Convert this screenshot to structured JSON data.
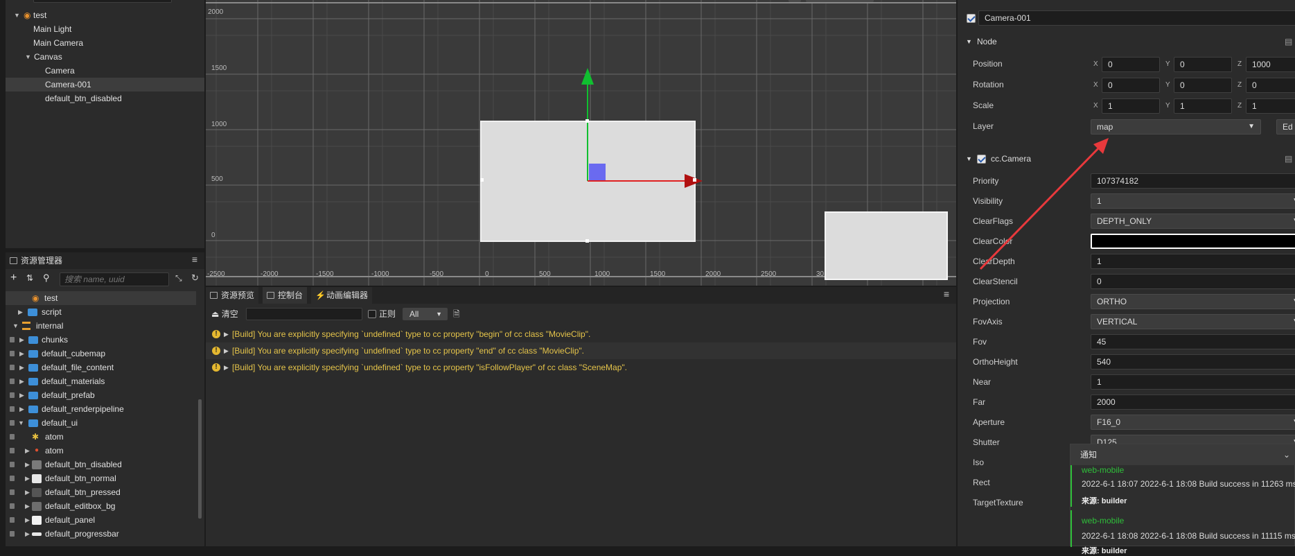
{
  "hierarchy": {
    "items": [
      "test",
      "Main Light",
      "Main Camera",
      "Canvas",
      "Camera",
      "Camera-001",
      "default_btn_disabled"
    ]
  },
  "assets": {
    "tab_label": "资源管理器",
    "search_placeholder": "搜索 name, uuid",
    "items": [
      "test",
      "script",
      "internal",
      "chunks",
      "default_cubemap",
      "default_file_content",
      "default_materials",
      "default_prefab",
      "default_renderpipeline",
      "default_ui",
      "atom",
      "atom",
      "default_btn_disabled",
      "default_btn_normal",
      "default_btn_pressed",
      "default_editbox_bg",
      "default_panel",
      "default_progressbar"
    ]
  },
  "scene": {
    "y_ticks": [
      "2000",
      "1500",
      "1000",
      "500",
      "0"
    ],
    "x_ticks": [
      "-2500",
      "-2000",
      "-1500",
      "-1000",
      "-500",
      "0",
      "500",
      "1000",
      "1500",
      "2000",
      "2500",
      "30"
    ]
  },
  "console": {
    "tabs": [
      "资源预览",
      "控制台",
      "动画编辑器"
    ],
    "clear_label": "清空",
    "regex_label": "正则",
    "filter_value": "All",
    "messages": [
      "[Build] You are explicitly specifying `undefined` type to cc property \"begin\" of cc class \"MovieClip\".",
      "[Build] You are explicitly specifying `undefined` type to cc property \"end\" of cc class \"MovieClip\".",
      "[Build] You are explicitly specifying `undefined` type to cc property \"isFollowPlayer\" of cc class \"SceneMap\"."
    ]
  },
  "inspector": {
    "node_name": "Camera-001",
    "node_section": "Node",
    "position_label": "Position",
    "position": {
      "x": "0",
      "y": "0",
      "z": "1000"
    },
    "rotation_label": "Rotation",
    "rotation": {
      "x": "0",
      "y": "0",
      "z": "0"
    },
    "scale_label": "Scale",
    "scale": {
      "x": "1",
      "y": "1",
      "z": "1"
    },
    "layer_label": "Layer",
    "layer_value": "map",
    "edit_label": "Ed",
    "axis_x": "X",
    "axis_y": "Y",
    "axis_z": "Z",
    "camera_section": "cc.Camera",
    "props": [
      {
        "label": "Priority",
        "value": "107374182",
        "kind": "input"
      },
      {
        "label": "Visibility",
        "value": "1",
        "kind": "select"
      },
      {
        "label": "ClearFlags",
        "value": "DEPTH_ONLY",
        "kind": "select"
      },
      {
        "label": "ClearColor",
        "value": "",
        "kind": "color"
      },
      {
        "label": "ClearDepth",
        "value": "1",
        "kind": "input"
      },
      {
        "label": "ClearStencil",
        "value": "0",
        "kind": "input"
      },
      {
        "label": "Projection",
        "value": "ORTHO",
        "kind": "select"
      },
      {
        "label": "FovAxis",
        "value": "VERTICAL",
        "kind": "select"
      },
      {
        "label": "Fov",
        "value": "45",
        "kind": "input"
      },
      {
        "label": "OrthoHeight",
        "value": "540",
        "kind": "input"
      },
      {
        "label": "Near",
        "value": "1",
        "kind": "input"
      },
      {
        "label": "Far",
        "value": "2000",
        "kind": "input"
      },
      {
        "label": "Aperture",
        "value": "F16_0",
        "kind": "select"
      },
      {
        "label": "Shutter",
        "value": "D125",
        "kind": "select"
      },
      {
        "label": "Iso",
        "value": "",
        "kind": "none"
      },
      {
        "label": "Rect",
        "value": "",
        "kind": "none"
      },
      {
        "label": "TargetTexture",
        "value": "",
        "kind": "none"
      }
    ]
  },
  "notice": {
    "title": "通知",
    "items": [
      {
        "platform": "web-mobile",
        "text": "2022-6-1 18:07 2022-6-1 18:08 Build success in 11263 ms",
        "source": "来源: builder"
      },
      {
        "platform": "web-mobile",
        "text": "2022-6-1 18:08 2022-6-1 18:08 Build success in 11115 ms",
        "source": "来源: builder"
      }
    ]
  },
  "colors": {
    "accent_green": "#2fbf3a",
    "warn": "#e5c44a",
    "gizmo_x": "#e02020",
    "gizmo_y": "#10c030",
    "arrow": "#e8393c"
  }
}
